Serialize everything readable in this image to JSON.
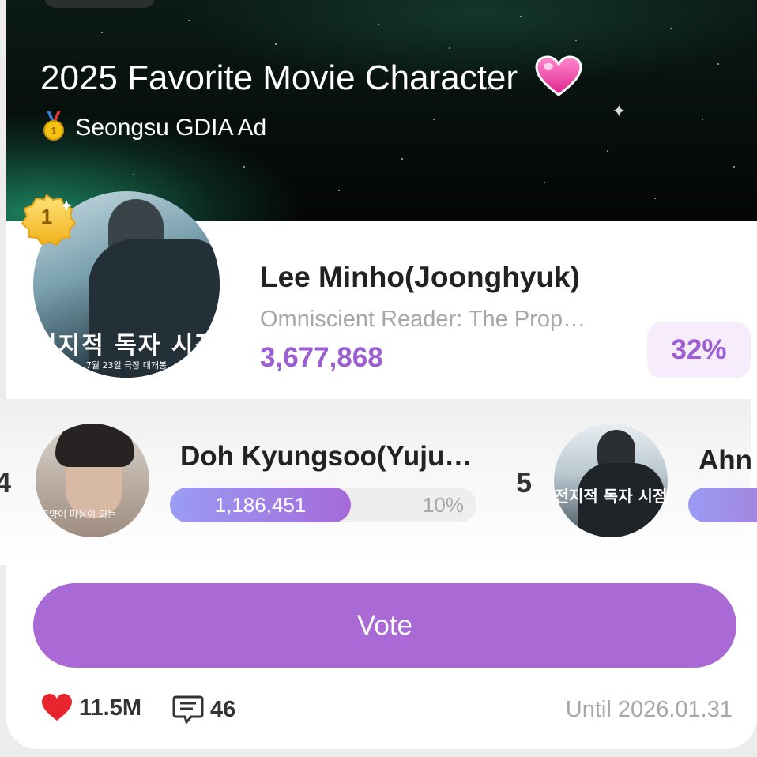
{
  "banner": {
    "title": "2025 Favorite Movie Character",
    "subtitle": "Seongsu GDIA Ad",
    "title_icon": "pink-heart-icon",
    "subtitle_icon": "gold-medal-icon"
  },
  "first_place": {
    "rank": "1",
    "name": "Lee Minho(Joonghyuk)",
    "movie": "Omniscient Reader: The Prop…",
    "votes": "3,677,868",
    "percent": "32%",
    "poster_text": "전지적 독자 시점",
    "poster_date": "7월 23일 극장 대개봉"
  },
  "runners_up": [
    {
      "rank": "4",
      "name": "Doh Kyungsoo(Yuju…",
      "votes": "1,186,451",
      "percent": "10%",
      "fill_ratio": 0.59,
      "poster_text": "고양이 마음이 되는"
    },
    {
      "rank": "5",
      "name": "Ahn",
      "poster_text": "전지적 독자 시점"
    }
  ],
  "vote_button": {
    "label": "Vote"
  },
  "footer": {
    "likes": "11.5M",
    "comments": "46",
    "until": "Until 2026.01.31"
  },
  "colors": {
    "accent": "#a96ad6",
    "vote_text": "#9b5fd1",
    "heart": "#e8252f",
    "muted": "#a7a7a7"
  }
}
